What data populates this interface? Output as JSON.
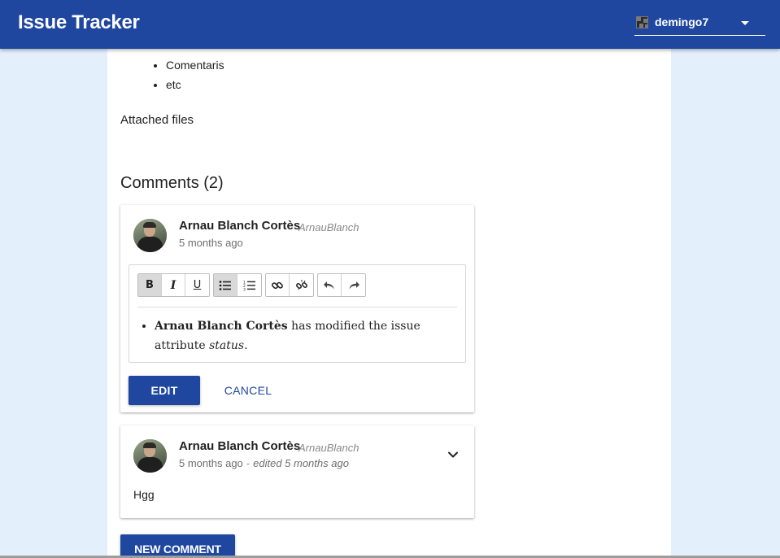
{
  "appbar": {
    "title": "Issue Tracker",
    "user_name": "demingo7",
    "background_color": "#1f47a0"
  },
  "issue": {
    "description_items": [
      "Comentaris",
      "etc"
    ],
    "attached_files_label": "Attached files"
  },
  "comments": {
    "heading": "Comments (2)",
    "items": [
      {
        "author": "Arnau Blanch Cortès",
        "username": "ArnauBlanch",
        "time": "5 months ago",
        "editing": true,
        "toolbar": {
          "bold": "B",
          "italic": "I",
          "underline": "U",
          "icons": [
            "bulleted-list-icon",
            "numbered-list-icon",
            "link-icon",
            "unlink-icon",
            "undo-icon",
            "redo-icon"
          ],
          "active": [
            "bold",
            "bulleted-list"
          ]
        },
        "editor_text": {
          "bold_part": "Arnau Blanch Cortès",
          "middle_part": " has modified the issue attribute ",
          "italic_part": "status",
          "end_part": "."
        },
        "edit_label": "EDIT",
        "cancel_label": "CANCEL"
      },
      {
        "author": "Arnau Blanch Cortès",
        "username": "ArnauBlanch",
        "time": "5 months ago",
        "separator": "-",
        "edited": "edited 5 months ago",
        "body": "Hgg",
        "menu_icon": "chevron-down-icon"
      }
    ]
  },
  "new_comment_label": "NEW COMMENT"
}
